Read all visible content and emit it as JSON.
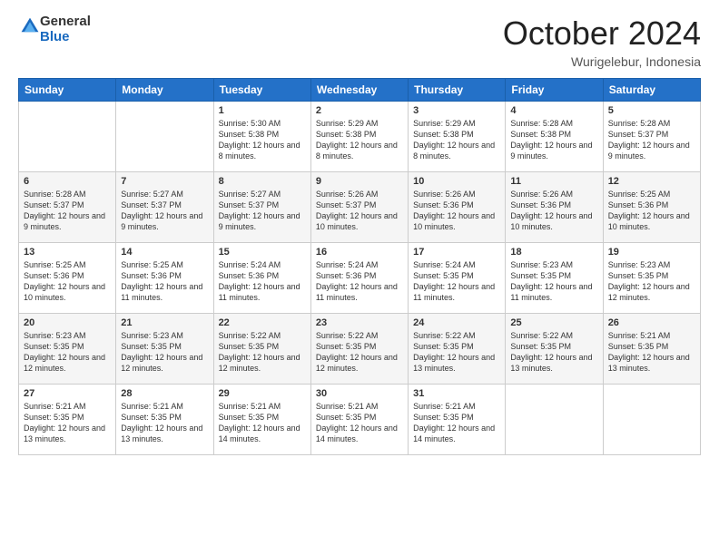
{
  "logo": {
    "general": "General",
    "blue": "Blue"
  },
  "header": {
    "month": "October 2024",
    "location": "Wurigelebur, Indonesia"
  },
  "days_of_week": [
    "Sunday",
    "Monday",
    "Tuesday",
    "Wednesday",
    "Thursday",
    "Friday",
    "Saturday"
  ],
  "weeks": [
    [
      {
        "day": "",
        "content": ""
      },
      {
        "day": "",
        "content": ""
      },
      {
        "day": "1",
        "content": "Sunrise: 5:30 AM\nSunset: 5:38 PM\nDaylight: 12 hours and 8 minutes."
      },
      {
        "day": "2",
        "content": "Sunrise: 5:29 AM\nSunset: 5:38 PM\nDaylight: 12 hours and 8 minutes."
      },
      {
        "day": "3",
        "content": "Sunrise: 5:29 AM\nSunset: 5:38 PM\nDaylight: 12 hours and 8 minutes."
      },
      {
        "day": "4",
        "content": "Sunrise: 5:28 AM\nSunset: 5:38 PM\nDaylight: 12 hours and 9 minutes."
      },
      {
        "day": "5",
        "content": "Sunrise: 5:28 AM\nSunset: 5:37 PM\nDaylight: 12 hours and 9 minutes."
      }
    ],
    [
      {
        "day": "6",
        "content": "Sunrise: 5:28 AM\nSunset: 5:37 PM\nDaylight: 12 hours and 9 minutes."
      },
      {
        "day": "7",
        "content": "Sunrise: 5:27 AM\nSunset: 5:37 PM\nDaylight: 12 hours and 9 minutes."
      },
      {
        "day": "8",
        "content": "Sunrise: 5:27 AM\nSunset: 5:37 PM\nDaylight: 12 hours and 9 minutes."
      },
      {
        "day": "9",
        "content": "Sunrise: 5:26 AM\nSunset: 5:37 PM\nDaylight: 12 hours and 10 minutes."
      },
      {
        "day": "10",
        "content": "Sunrise: 5:26 AM\nSunset: 5:36 PM\nDaylight: 12 hours and 10 minutes."
      },
      {
        "day": "11",
        "content": "Sunrise: 5:26 AM\nSunset: 5:36 PM\nDaylight: 12 hours and 10 minutes."
      },
      {
        "day": "12",
        "content": "Sunrise: 5:25 AM\nSunset: 5:36 PM\nDaylight: 12 hours and 10 minutes."
      }
    ],
    [
      {
        "day": "13",
        "content": "Sunrise: 5:25 AM\nSunset: 5:36 PM\nDaylight: 12 hours and 10 minutes."
      },
      {
        "day": "14",
        "content": "Sunrise: 5:25 AM\nSunset: 5:36 PM\nDaylight: 12 hours and 11 minutes."
      },
      {
        "day": "15",
        "content": "Sunrise: 5:24 AM\nSunset: 5:36 PM\nDaylight: 12 hours and 11 minutes."
      },
      {
        "day": "16",
        "content": "Sunrise: 5:24 AM\nSunset: 5:36 PM\nDaylight: 12 hours and 11 minutes."
      },
      {
        "day": "17",
        "content": "Sunrise: 5:24 AM\nSunset: 5:35 PM\nDaylight: 12 hours and 11 minutes."
      },
      {
        "day": "18",
        "content": "Sunrise: 5:23 AM\nSunset: 5:35 PM\nDaylight: 12 hours and 11 minutes."
      },
      {
        "day": "19",
        "content": "Sunrise: 5:23 AM\nSunset: 5:35 PM\nDaylight: 12 hours and 12 minutes."
      }
    ],
    [
      {
        "day": "20",
        "content": "Sunrise: 5:23 AM\nSunset: 5:35 PM\nDaylight: 12 hours and 12 minutes."
      },
      {
        "day": "21",
        "content": "Sunrise: 5:23 AM\nSunset: 5:35 PM\nDaylight: 12 hours and 12 minutes."
      },
      {
        "day": "22",
        "content": "Sunrise: 5:22 AM\nSunset: 5:35 PM\nDaylight: 12 hours and 12 minutes."
      },
      {
        "day": "23",
        "content": "Sunrise: 5:22 AM\nSunset: 5:35 PM\nDaylight: 12 hours and 12 minutes."
      },
      {
        "day": "24",
        "content": "Sunrise: 5:22 AM\nSunset: 5:35 PM\nDaylight: 12 hours and 13 minutes."
      },
      {
        "day": "25",
        "content": "Sunrise: 5:22 AM\nSunset: 5:35 PM\nDaylight: 12 hours and 13 minutes."
      },
      {
        "day": "26",
        "content": "Sunrise: 5:21 AM\nSunset: 5:35 PM\nDaylight: 12 hours and 13 minutes."
      }
    ],
    [
      {
        "day": "27",
        "content": "Sunrise: 5:21 AM\nSunset: 5:35 PM\nDaylight: 12 hours and 13 minutes."
      },
      {
        "day": "28",
        "content": "Sunrise: 5:21 AM\nSunset: 5:35 PM\nDaylight: 12 hours and 13 minutes."
      },
      {
        "day": "29",
        "content": "Sunrise: 5:21 AM\nSunset: 5:35 PM\nDaylight: 12 hours and 14 minutes."
      },
      {
        "day": "30",
        "content": "Sunrise: 5:21 AM\nSunset: 5:35 PM\nDaylight: 12 hours and 14 minutes."
      },
      {
        "day": "31",
        "content": "Sunrise: 5:21 AM\nSunset: 5:35 PM\nDaylight: 12 hours and 14 minutes."
      },
      {
        "day": "",
        "content": ""
      },
      {
        "day": "",
        "content": ""
      }
    ]
  ]
}
